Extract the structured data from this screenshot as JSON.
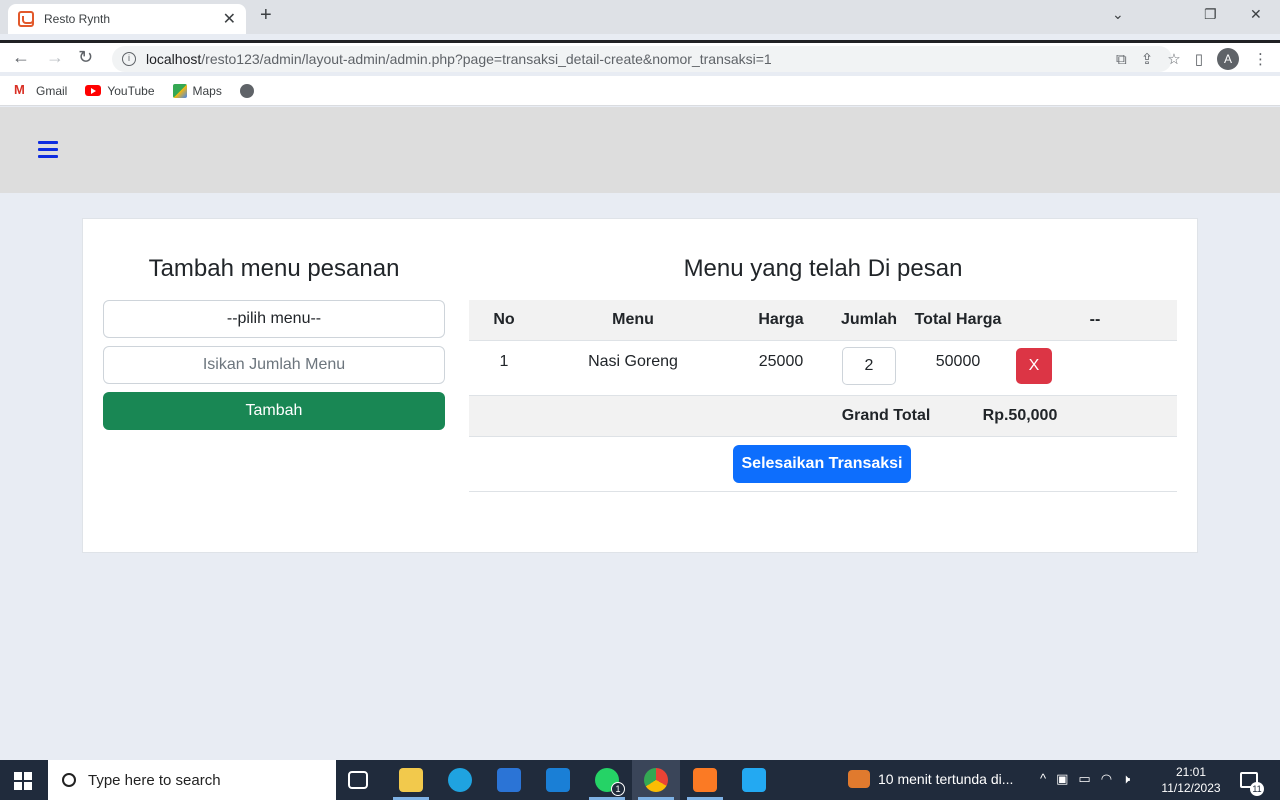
{
  "browser": {
    "tab_title": "Resto Rynth",
    "url_host": "localhost",
    "url_path": "/resto123/admin/layout-admin/admin.php?page=transaksi_detail-create&nomor_transaksi=1",
    "avatar_letter": "A",
    "bookmarks": [
      {
        "label": "Gmail",
        "icon": "gmail-icon"
      },
      {
        "label": "YouTube",
        "icon": "youtube-icon"
      },
      {
        "label": "Maps",
        "icon": "maps-icon"
      }
    ]
  },
  "left": {
    "title": "Tambah menu pesanan",
    "select_value": "--pilih menu--",
    "qty_placeholder": "Isikan Jumlah Menu",
    "add_button": "Tambah"
  },
  "right": {
    "title": "Menu yang telah Di pesan",
    "headers": [
      "No",
      "Menu",
      "Harga",
      "Jumlah",
      "Total Harga",
      "--"
    ],
    "rows": [
      {
        "no": "1",
        "menu": "Nasi Goreng",
        "harga": "25000",
        "jumlah": "2",
        "total": "50000",
        "delete_label": "X"
      }
    ],
    "grand_total_label": "Grand Total",
    "grand_total_value": "Rp.50,000",
    "finish_button": "Selesaikan Transaksi"
  },
  "taskbar": {
    "search_placeholder": "Type here to search",
    "notification": "10 menit tertunda di...",
    "time": "21:01",
    "date": "11/12/2023",
    "whatsapp_badge": "1",
    "message_badge": "11"
  },
  "colors": {
    "green": "#198754",
    "blue": "#0d6efd",
    "red": "#dc3545",
    "hamburger": "#0d2ce0"
  }
}
